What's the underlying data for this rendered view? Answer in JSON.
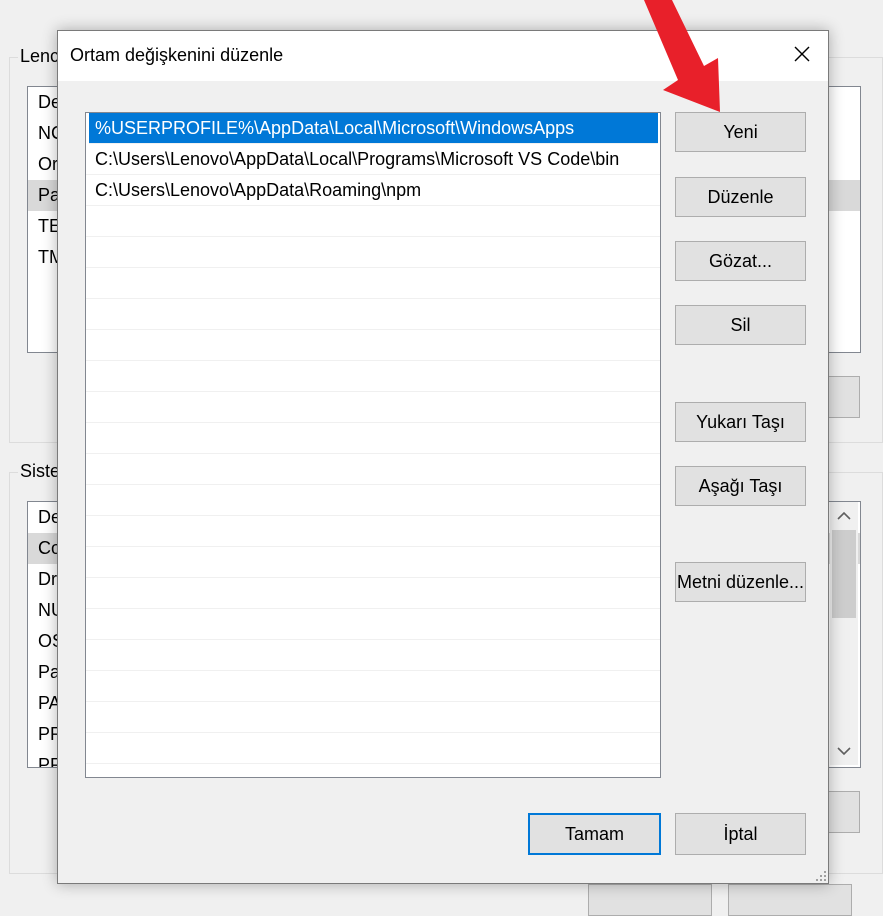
{
  "background": {
    "user_group_title": "Lenc",
    "user_vars": [
      "De",
      "NC",
      "Or",
      "Pa",
      "TE",
      "TM"
    ],
    "system_group_title": "Siste",
    "system_vars": [
      "De",
      "Co",
      "Dr",
      "NU",
      "OS",
      "Pa",
      "PA",
      "PR",
      "PR"
    ]
  },
  "dialog": {
    "title": "Ortam değişkenini düzenle",
    "close_glyph": "✕",
    "paths": [
      "%USERPROFILE%\\AppData\\Local\\Microsoft\\WindowsApps",
      "C:\\Users\\Lenovo\\AppData\\Local\\Programs\\Microsoft VS Code\\bin",
      "C:\\Users\\Lenovo\\AppData\\Roaming\\npm"
    ],
    "selected_index": 0,
    "buttons": {
      "new": "Yeni",
      "edit": "Düzenle",
      "browse": "Gözat...",
      "delete": "Sil",
      "move_up": "Yukarı Taşı",
      "move_down": "Aşağı Taşı",
      "edit_text": "Metni düzenle..."
    },
    "ok": "Tamam",
    "cancel": "İptal"
  },
  "colors": {
    "selection": "#0078d7",
    "annotation_arrow": "#e8202a"
  },
  "icons": [
    "close-icon",
    "red-arrow-icon",
    "resize-grip-icon",
    "scroll-up-icon",
    "scroll-down-icon"
  ]
}
